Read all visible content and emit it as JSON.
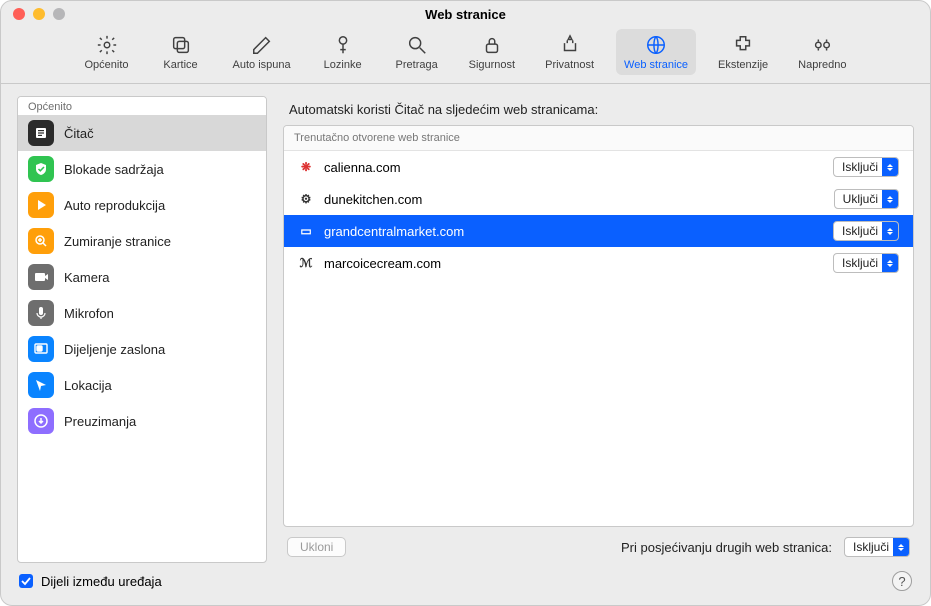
{
  "window_title": "Web stranice",
  "toolbar": [
    {
      "id": "general",
      "label": "Općenito"
    },
    {
      "id": "tabs",
      "label": "Kartice"
    },
    {
      "id": "autofill",
      "label": "Auto ispuna"
    },
    {
      "id": "passwords",
      "label": "Lozinke"
    },
    {
      "id": "search",
      "label": "Pretraga"
    },
    {
      "id": "security",
      "label": "Sigurnost"
    },
    {
      "id": "privacy",
      "label": "Privatnost"
    },
    {
      "id": "websites",
      "label": "Web stranice"
    },
    {
      "id": "extensions",
      "label": "Ekstenzije"
    },
    {
      "id": "advanced",
      "label": "Napredno"
    }
  ],
  "sidebar": {
    "heading": "Općenito",
    "items": [
      {
        "label": "Čitač",
        "color": "#2b2b2b"
      },
      {
        "label": "Blokade sadržaja",
        "color": "#30c451"
      },
      {
        "label": "Auto reprodukcija",
        "color": "#ff9f0a"
      },
      {
        "label": "Zumiranje stranice",
        "color": "#ff9f0a"
      },
      {
        "label": "Kamera",
        "color": "#6e6e6e"
      },
      {
        "label": "Mikrofon",
        "color": "#6e6e6e"
      },
      {
        "label": "Dijeljenje zaslona",
        "color": "#0a84ff"
      },
      {
        "label": "Lokacija",
        "color": "#0a84ff"
      },
      {
        "label": "Preuzimanja",
        "color": "#8e6eff"
      }
    ]
  },
  "main": {
    "heading": "Automatski koristi Čitač na sljedećim web stranicama:",
    "subheading": "Trenutačno otvorene web stranice",
    "sites": [
      {
        "label": "calienna.com",
        "value": "Isključi",
        "icon": "❋",
        "iconColor": "#d33"
      },
      {
        "label": "dunekitchen.com",
        "value": "Uključi",
        "icon": "⚙",
        "iconColor": "#333"
      },
      {
        "label": "grandcentralmarket.com",
        "value": "Isključi",
        "icon": "▭",
        "iconColor": "#fff",
        "selected": true
      },
      {
        "label": "marcoicecream.com",
        "value": "Isključi",
        "icon": "ℳ",
        "iconColor": "#333"
      }
    ],
    "remove_label": "Ukloni",
    "other_label": "Pri posjećivanju drugih web stranica:",
    "other_value": "Isključi"
  },
  "share_checkbox": {
    "label": "Dijeli između uređaja",
    "checked": true
  }
}
